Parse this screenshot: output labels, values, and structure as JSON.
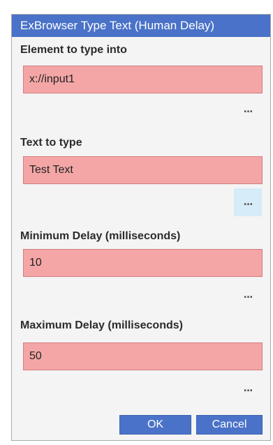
{
  "dialog": {
    "title": "ExBrowser Type Text (Human Delay)",
    "fields": [
      {
        "label": "Element to type into",
        "value": "x://input1",
        "browse_glyph": "..."
      },
      {
        "label": "Text to type",
        "value": "Test Text",
        "browse_glyph": "..."
      },
      {
        "label": "Minimum Delay (milliseconds)",
        "value": "10",
        "browse_glyph": "..."
      },
      {
        "label": "Maximum Delay (milliseconds)",
        "value": "50",
        "browse_glyph": "..."
      }
    ],
    "ok_label": "OK",
    "cancel_label": "Cancel"
  },
  "colors": {
    "title_bar": "#4a72c8",
    "invalid_field": "#f4a6a6",
    "button": "#4a72c8",
    "hover_highlight": "#d6ecf8"
  },
  "icons": {
    "browse": "ellipsis-icon"
  }
}
